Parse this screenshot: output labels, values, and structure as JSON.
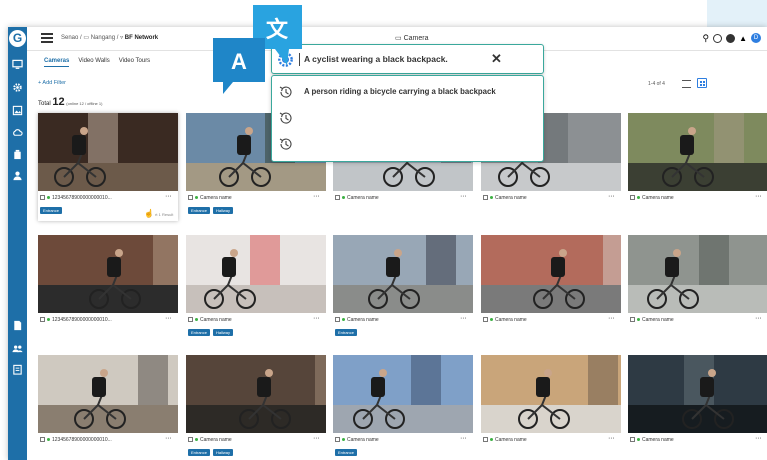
{
  "app": {
    "breadcrumb": [
      "Senao",
      "Nangang",
      "BF Network"
    ],
    "title": "Camera",
    "avatar_initial": "D"
  },
  "tabs": [
    "Cameras",
    "Video Walls",
    "Video Tours"
  ],
  "add_filter": "+ Add Filter",
  "total": {
    "label": "Total",
    "count": "12",
    "detail": "(online 12 / offline 1)"
  },
  "pager": "1-4 of 4",
  "search": {
    "query": "A cyclist wearing a black backpack."
  },
  "history": [
    "A person riding a bicycle carrying a black backpack",
    "",
    ""
  ],
  "translate": {
    "glyph_left": "A",
    "glyph_right": "文"
  },
  "cameras": [
    {
      "name": "12345678900000000010...",
      "tags": [
        "Entrance"
      ],
      "note": "rt 1 Result"
    },
    {
      "name": "Camera name",
      "tags": [
        "Entrance",
        "Hallway"
      ]
    },
    {
      "name": "Camera name",
      "tags": []
    },
    {
      "name": "Camera name",
      "tags": []
    },
    {
      "name": "Camera name",
      "tags": []
    },
    {
      "name": "12345678900000000010...",
      "tags": []
    },
    {
      "name": "Camera name",
      "tags": [
        "Entrance",
        "Hallway"
      ]
    },
    {
      "name": "Camera name",
      "tags": [
        "Entrance"
      ]
    },
    {
      "name": "Camera name",
      "tags": []
    },
    {
      "name": "Camera name",
      "tags": []
    },
    {
      "name": "12345678900000000010...",
      "tags": []
    },
    {
      "name": "Camera name",
      "tags": [
        "Entrance",
        "Hallway"
      ]
    },
    {
      "name": "Camera name",
      "tags": [
        "Entrance"
      ]
    },
    {
      "name": "Camera name",
      "tags": []
    },
    {
      "name": "Camera name",
      "tags": []
    }
  ],
  "colors": {
    "brand": "#1e6fa8",
    "accent": "#3aa89c",
    "online": "#3cb043",
    "translate": "#1f86c8"
  }
}
